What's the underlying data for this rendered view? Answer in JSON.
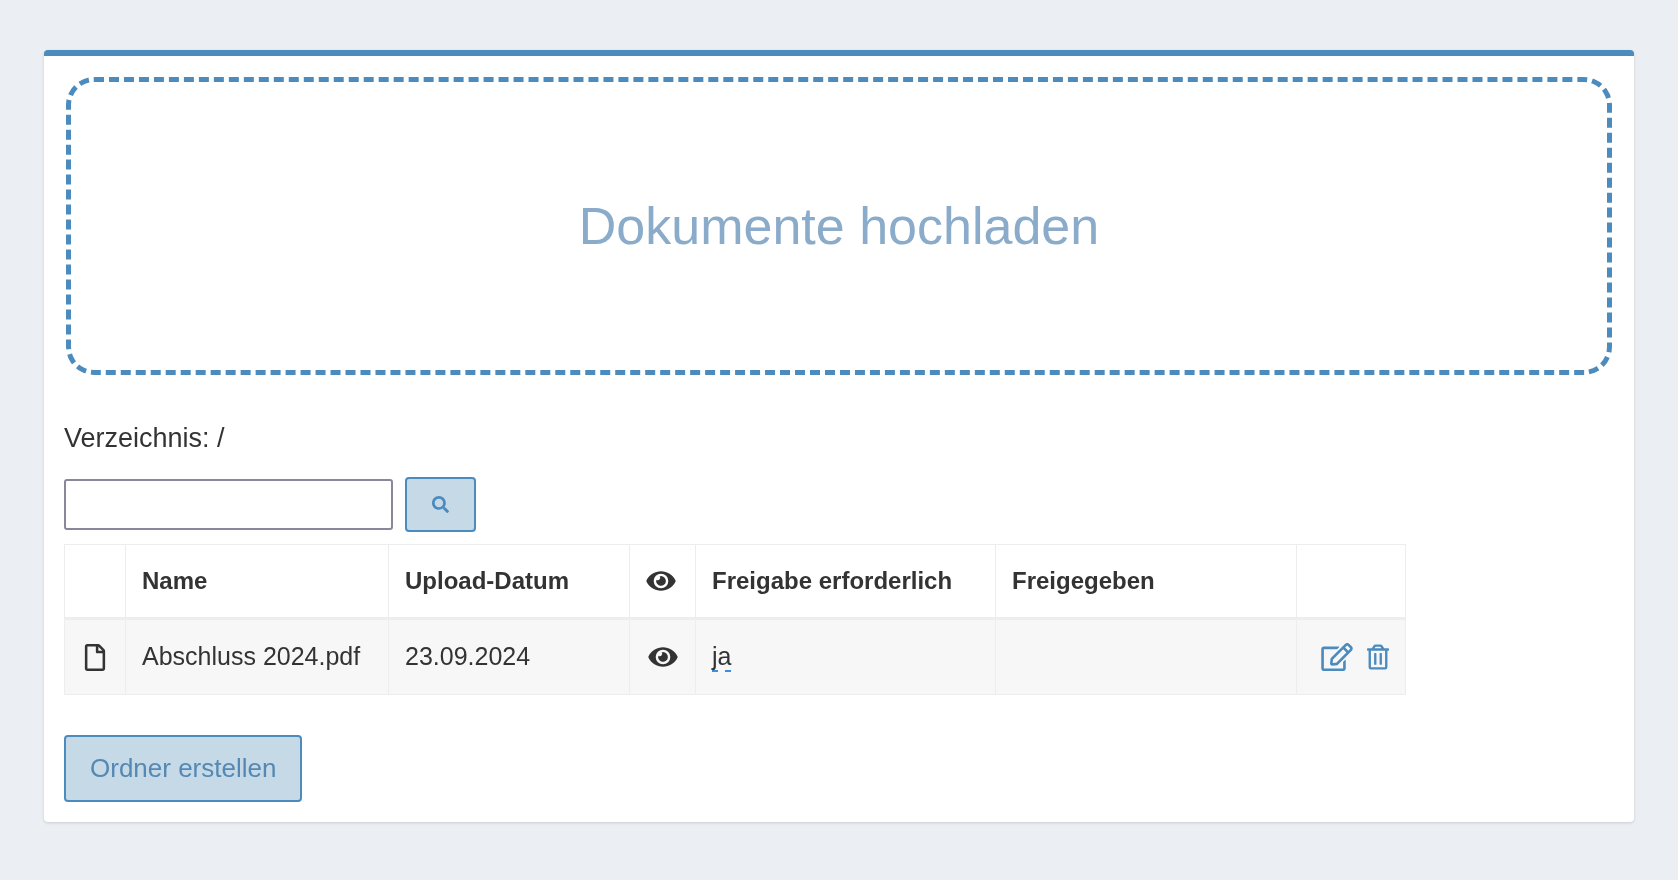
{
  "upload_zone": {
    "label": "Dokumente hochladen"
  },
  "directory": {
    "label": "Verzeichnis: /"
  },
  "table": {
    "columns": [
      {
        "kind": "blank"
      },
      {
        "kind": "text",
        "label": "Name"
      },
      {
        "kind": "text",
        "label": "Upload-Datum"
      },
      {
        "kind": "icon"
      },
      {
        "kind": "text",
        "label": "Freigabe erforderlich"
      },
      {
        "kind": "text",
        "label": "Freigegeben"
      },
      {
        "kind": "blank"
      }
    ],
    "rows": [
      {
        "name": "Abschluss 2024.pdf",
        "upload_date": "23.09.2024",
        "approval_required": "ja"
      }
    ]
  },
  "buttons": [
    {
      "label": "Ordner erstellen"
    }
  ]
}
